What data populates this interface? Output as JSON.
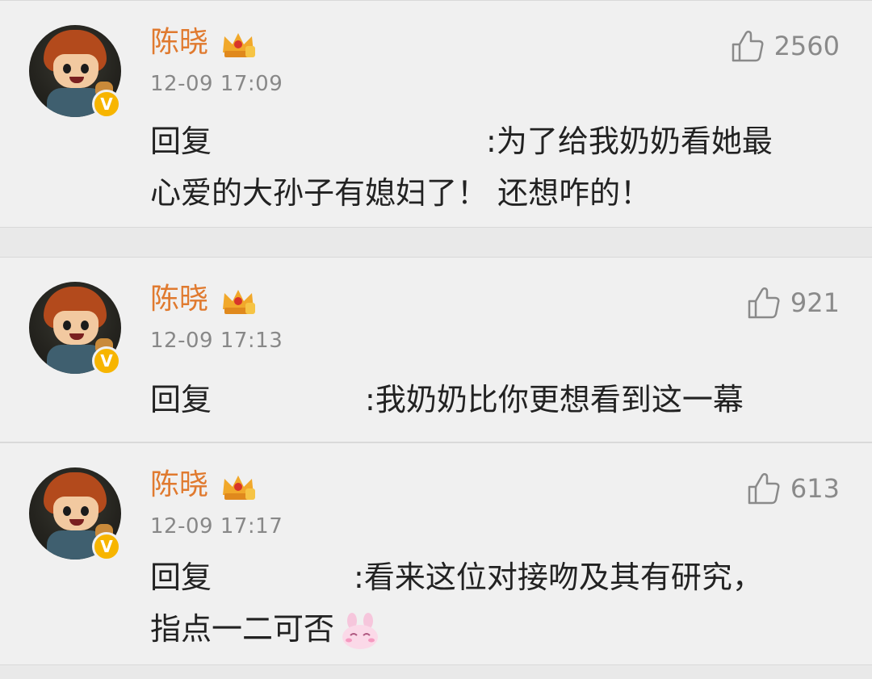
{
  "comments": [
    {
      "username": "陈晓",
      "time": "12-09 17:09",
      "likes": "2560",
      "reply_prefix": "回复",
      "lines": [
        ":为了给我奶奶看她最",
        "心爱的大孙子有媳妇了！ 还想咋的！"
      ]
    },
    {
      "username": "陈晓",
      "time": "12-09 17:13",
      "likes": "921",
      "reply_prefix": "回复",
      "lines": [
        ":我奶奶比你更想看到这一幕"
      ]
    },
    {
      "username": "陈晓",
      "time": "12-09 17:17",
      "likes": "613",
      "reply_prefix": "回复",
      "lines": [
        ":看来这位对接吻及其有研究，",
        "指点一二可否"
      ]
    }
  ],
  "icons": {
    "like": "thumbs-up-icon",
    "verified": "verified-v-icon",
    "vip": "vip-crown-icon",
    "emoji": "rabbit-emoji-icon"
  },
  "colors": {
    "username": "#e07a2f",
    "verified": "#f7b500",
    "background": "#f0f0f0"
  },
  "verified_mark": "V"
}
